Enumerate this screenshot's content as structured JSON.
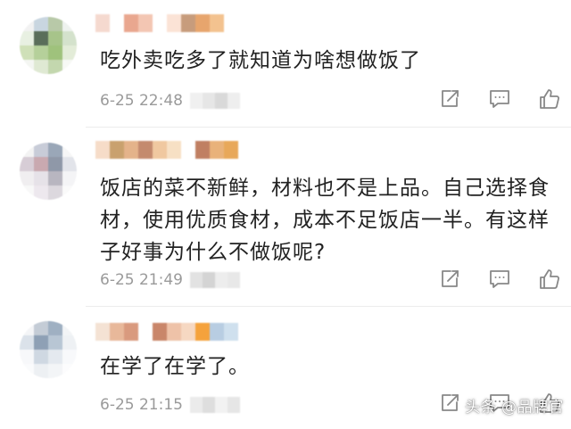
{
  "comments": [
    {
      "text": "吃外卖吃多了就知道为啥想做饭了",
      "time": "6-25 22:48",
      "avatar_colors": [
        "#f2f2f2",
        "#c9d6e0",
        "#b8c9a8",
        "#eef2ee",
        "#e8f0e2",
        "#5a6e5a",
        "#a7c48a",
        "#d4e2cc",
        "#cfe0b8",
        "#b5d09a",
        "#9fc27c",
        "#e3ecd8",
        "#f4f6f2",
        "#dfe9d3",
        "#c3d7ae",
        "#f7f9f5"
      ],
      "name_colors": [
        "#f5d9cf",
        "#ffffff",
        "#e9a78f",
        "#f3c6b3",
        "#ffffff",
        "#fbe3d6",
        "#c79c7c",
        "#e7a56d",
        "#f3c28f",
        "#ffffff"
      ],
      "tail_colors": [
        "#f0f0f0",
        "#e6e6e6",
        "#d9d9d9",
        "#eeeeee"
      ]
    },
    {
      "text": "饭店的菜不新鲜，材料也不是上品。自己选择食材，使用优质食材，成本不足饭店一半。有这样子好事为什么不做饭呢?",
      "time": "6-25 21:49",
      "avatar_colors": [
        "#f3f3f3",
        "#c8ccd8",
        "#9aa7b8",
        "#f6f6f6",
        "#d7cdd6",
        "#c9a9b0",
        "#8f98a8",
        "#e2e4ea",
        "#f0eef0",
        "#e6e2e8",
        "#b8b6c0",
        "#f4f4f6",
        "#f8f8f8",
        "#ede8ee",
        "#dcd8de",
        "#fafafa"
      ],
      "name_colors": [
        "#f6dcc8",
        "#c9a16e",
        "#e4b38a",
        "#c48a6e",
        "#f0c8a0",
        "#f7e0c4",
        "#ffffff",
        "#c07f62",
        "#e9b27a",
        "#e8a85a"
      ],
      "tail_colors": [
        "#e2e2e2",
        "#d4d4d4",
        "#ededed",
        "#e8e8e8"
      ]
    },
    {
      "text": "在学了在学了。",
      "time": "6-25 21:15",
      "avatar_colors": [
        "#f4f5f7",
        "#c4ccd6",
        "#9fb0c2",
        "#f2f4f6",
        "#dbe2ea",
        "#8ea0b5",
        "#b8c6d4",
        "#eef1f4",
        "#f7f8fa",
        "#cfd8e2",
        "#e4e9ef",
        "#f8f9fb",
        "#fafbfc",
        "#edf0f3",
        "#f3f5f7",
        "#fcfcfd"
      ],
      "name_colors": [
        "#f4e2d4",
        "#e8b89a",
        "#d99a7e",
        "#ffffff",
        "#c9866a",
        "#eec2a8",
        "#f6d8c2",
        "#f5a23c",
        "#b8cde2",
        "#cfe0ee"
      ],
      "tail_colors": [
        "#ebebeb",
        "#dedede",
        "#f2f2f2",
        "#e6e6e6"
      ]
    }
  ],
  "icons": {
    "share": "share-icon",
    "comment": "comment-icon",
    "like": "thumbs-up-icon",
    "color": "#888888"
  },
  "watermark": "头条 @品牌官"
}
